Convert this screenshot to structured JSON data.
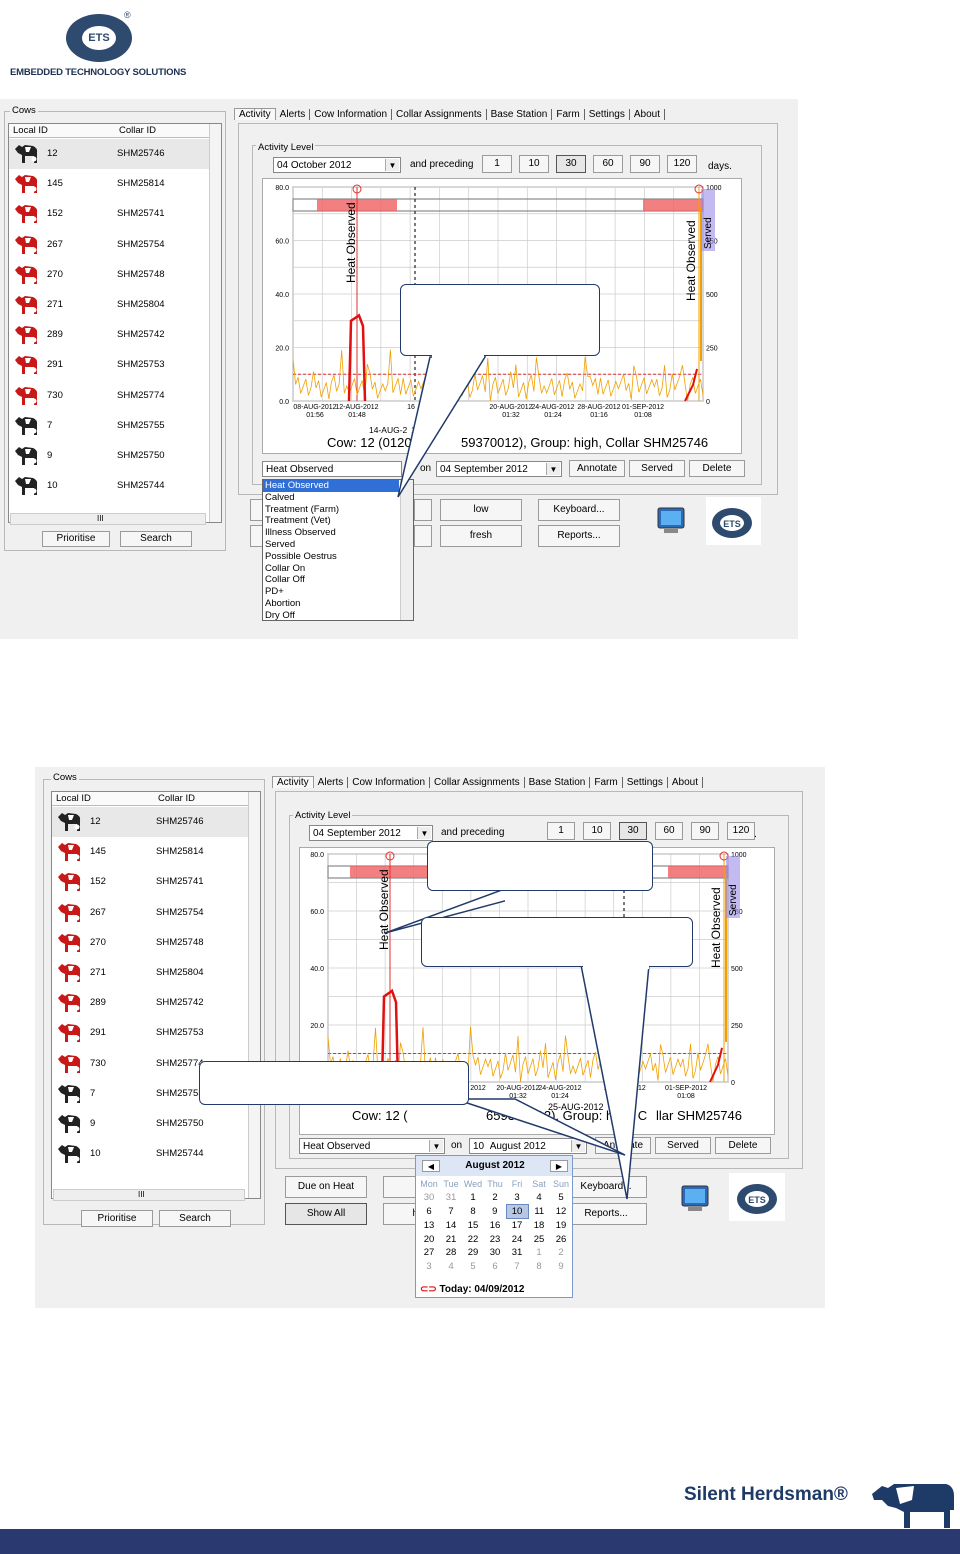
{
  "company": {
    "logo_text": "ETS",
    "registered": "®",
    "name": "EMBEDDED TECHNOLOGY SOLUTIONS"
  },
  "brand": {
    "name": "Silent Herdsman®"
  },
  "tabs": [
    "Activity",
    "Alerts",
    "Cow Information",
    "Collar Assignments",
    "Base Station",
    "Farm",
    "Settings",
    "About"
  ],
  "cows_group_label": "Cows",
  "list_headers": {
    "local_id": "Local ID",
    "collar_id": "Collar ID"
  },
  "cows": [
    {
      "id": "12",
      "collar": "SHM25746",
      "color": "black"
    },
    {
      "id": "145",
      "collar": "SHM25814",
      "color": "red"
    },
    {
      "id": "152",
      "collar": "SHM25741",
      "color": "red"
    },
    {
      "id": "267",
      "collar": "SHM25754",
      "color": "red"
    },
    {
      "id": "270",
      "collar": "SHM25748",
      "color": "red"
    },
    {
      "id": "271",
      "collar": "SHM25804",
      "color": "red"
    },
    {
      "id": "289",
      "collar": "SHM25742",
      "color": "red"
    },
    {
      "id": "291",
      "collar": "SHM25753",
      "color": "red"
    },
    {
      "id": "730",
      "collar": "SHM25774",
      "color": "red"
    },
    {
      "id": "7",
      "collar": "SHM25755",
      "color": "black"
    },
    {
      "id": "9",
      "collar": "SHM25750",
      "color": "black"
    },
    {
      "id": "10",
      "collar": "SHM25744",
      "color": "black"
    }
  ],
  "scrollbar_grip": "III",
  "buttons": {
    "prioritise": "Prioritise",
    "search": "Search",
    "low": "low",
    "fresh": "fresh",
    "keyboard": "Keyboard...",
    "reports": "Reports...",
    "annotate": "Annotate",
    "served": "Served",
    "delete": "Delete",
    "due_on_heat": "Due on Heat",
    "show_all": "Show All",
    "h_partial": "h"
  },
  "activity_level_label": "Activity Level",
  "and_preceding": "and preceding",
  "days_label": "days.",
  "day_options": [
    "1",
    "10",
    "30",
    "60",
    "90",
    "120"
  ],
  "selected_days": "30",
  "on_label": "on",
  "screen1": {
    "date": "04  October   2012",
    "annotation_type": "Heat Observed",
    "annotate_date": "04 September 2012",
    "chart_info": "Cow: 12 (0120",
    "chart_info2": "59370012), Group: high, Collar SHM25746",
    "date_marker": "14-AUG-2",
    "date_marker2": "17:16",
    "dropdown_options": [
      "Heat Observed",
      "Calved",
      "Treatment (Farm)",
      "Treatment (Vet)",
      "Illness Observed",
      "Served",
      "Possible Oestrus",
      "Collar On",
      "Collar Off",
      "PD+",
      "Abortion",
      "Dry Off"
    ]
  },
  "screen2": {
    "date": "04 September 2012",
    "annotation_type": "Heat Observed",
    "annotate_day": "10",
    "annotate_month_year": "August   2012",
    "chart_info": "Cow: 12 (",
    "chart_info2": "659370012), Group: high, C",
    "chart_info3": "llar SHM25746",
    "date_marker": "25-AUG-2012",
    "date_marker2": "5",
    "calendar": {
      "month": "August 2012",
      "weekdays": [
        "Mon",
        "Tue",
        "Wed",
        "Thu",
        "Fri",
        "Sat",
        "Sun"
      ],
      "weeks": [
        [
          "30",
          "31",
          "1",
          "2",
          "3",
          "4",
          "5"
        ],
        [
          "6",
          "7",
          "8",
          "9",
          "10",
          "11",
          "12"
        ],
        [
          "13",
          "14",
          "15",
          "16",
          "17",
          "18",
          "19"
        ],
        [
          "20",
          "21",
          "22",
          "23",
          "24",
          "25",
          "26"
        ],
        [
          "27",
          "28",
          "29",
          "30",
          "31",
          "1",
          "2"
        ],
        [
          "3",
          "4",
          "5",
          "6",
          "7",
          "8",
          "9"
        ]
      ],
      "selected": "10",
      "today": "Today: 04/09/2012"
    }
  },
  "chart_data": [
    {
      "type": "line",
      "title": "Cow: 12 (0120…59370012), Group: high, Collar SHM25746",
      "ylim_left": [
        0,
        80
      ],
      "y_ticks_left": [
        "80.0",
        "60.0",
        "40.0",
        "20.0",
        "0.0"
      ],
      "ylim_right": [
        0,
        1000
      ],
      "y_ticks_right": [
        "1000",
        "750",
        "500",
        "250",
        "0"
      ],
      "x_ticks": [
        {
          "date": "08-AUG-2012",
          "time": "01:56"
        },
        {
          "date": "12-AUG-2012",
          "time": "01:48"
        },
        {
          "date": "16",
          "time": ""
        },
        {
          "date": "2",
          "time": ""
        },
        {
          "date": "20-AUG-2012",
          "time": "01:32"
        },
        {
          "date": "24-AUG-2012",
          "time": "01:24"
        },
        {
          "date": "28-AUG-2012",
          "time": "01:16"
        },
        {
          "date": "01-SEP-2012",
          "time": "01:08"
        }
      ],
      "annotations": [
        "Heat Observed",
        "Heat Observed",
        "Served"
      ],
      "threshold": 10
    },
    {
      "type": "line",
      "title": "Cow: 12 (…659370012), Group: high, Collar SHM25746",
      "ylim_left": [
        0,
        80
      ],
      "y_ticks_left": [
        "80.0",
        "60.0",
        "40.0",
        "20.0"
      ],
      "ylim_right": [
        0,
        1000
      ],
      "y_ticks_right": [
        "1000",
        "750",
        "500",
        "250",
        "0"
      ],
      "x_ticks": [
        {
          "date": "2012",
          "time": ""
        },
        {
          "date": "20-AUG-2012",
          "time": "01:32"
        },
        {
          "date": "24-AUG-2012",
          "time": "01:24"
        },
        {
          "date": "2",
          "time": ""
        },
        {
          "date": "2012",
          "time": ""
        },
        {
          "date": "01-SEP-2012",
          "time": "01:08"
        }
      ],
      "annotations": [
        "Heat Observed",
        "Heat Observed",
        "Served"
      ],
      "threshold": 10
    }
  ],
  "colors": {
    "heat_red": "#e01010",
    "activity_orange": "#f0a000",
    "threshold_red": "#e03030",
    "brand_navy": "#2a3a70"
  }
}
